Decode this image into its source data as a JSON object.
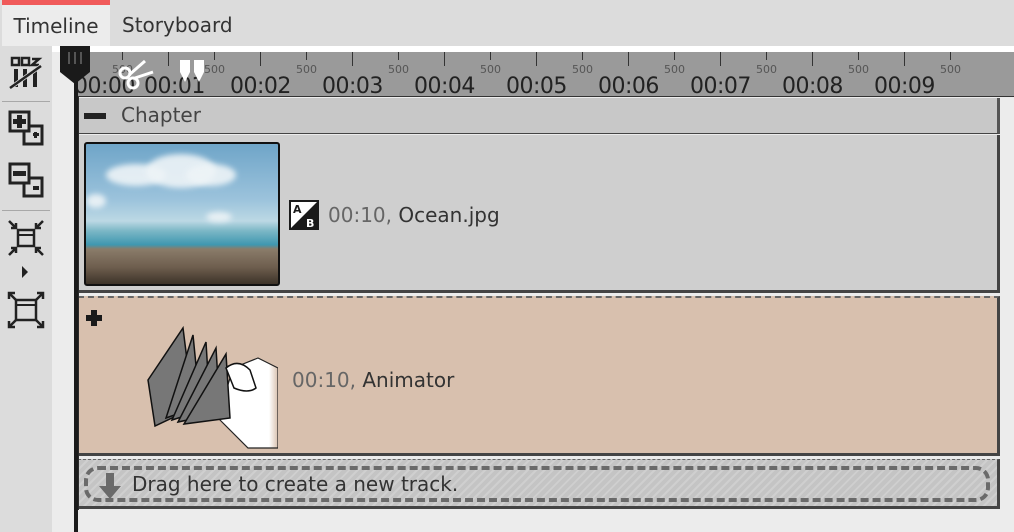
{
  "tabs": [
    {
      "label": "Timeline",
      "active": true
    },
    {
      "label": "Storyboard",
      "active": false
    }
  ],
  "accent_color": "#f05a5a",
  "toolbar": {
    "tools": [
      {
        "name": "snap-grid-toggle",
        "icon": "snap-icon"
      },
      {
        "name": "expand-all",
        "icon": "expand-all-icon"
      },
      {
        "name": "collapse-all",
        "icon": "collapse-all-icon"
      },
      {
        "name": "zoom-fit",
        "icon": "zoom-in-fit-icon"
      },
      {
        "name": "zoom-out-full",
        "icon": "zoom-out-fit-icon"
      }
    ]
  },
  "ruler": {
    "times": [
      "00:00",
      "00:01",
      "00:02",
      "00:03",
      "00:04",
      "00:05",
      "00:06",
      "00:07",
      "00:08",
      "00:09"
    ],
    "sub_label": "500"
  },
  "chapter": {
    "title": "Chapter",
    "collapse_symbol": "minus"
  },
  "tracks": [
    {
      "duration": "00:10,",
      "name": "Ocean.jpg",
      "transition_icon": "ab-transition-icon",
      "color": "#cfcfcf"
    },
    {
      "duration": "00:10,",
      "name": "Animator",
      "color": "#d8c0ae"
    }
  ],
  "dropzone": {
    "text": "Drag here to create a new track."
  }
}
